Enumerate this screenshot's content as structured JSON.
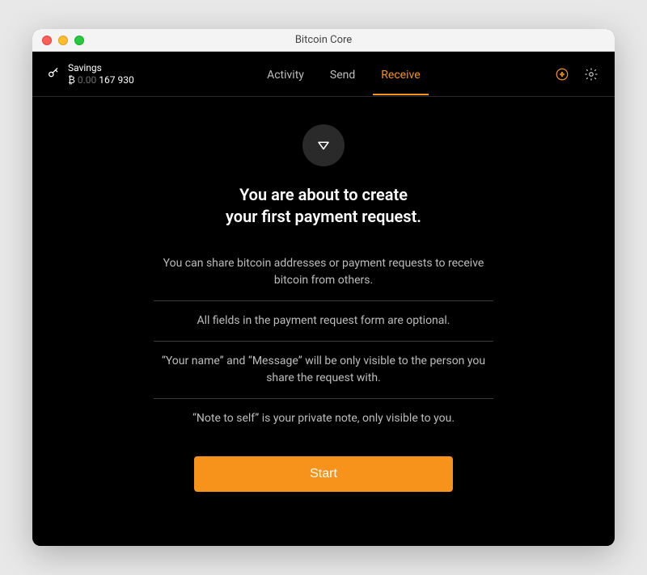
{
  "window": {
    "title": "Bitcoin Core"
  },
  "wallet": {
    "name": "Savings",
    "balance_symbol": "₿",
    "balance_leading_zeros": "0.00",
    "balance_rest": " 167 930"
  },
  "nav": {
    "activity": "Activity",
    "send": "Send",
    "receive": "Receive"
  },
  "headline": {
    "line1": "You are about to create",
    "line2": "your first payment request."
  },
  "info": {
    "item1": "You can share bitcoin addresses or payment requests to receive bitcoin from others.",
    "item2": "All fields in the payment request form are optional.",
    "item3": "“Your name” and “Message” will be only visible to the person you share the request with.",
    "item4": "“Note to self” is your private note, only visible to you."
  },
  "buttons": {
    "start": "Start"
  },
  "colors": {
    "accent": "#f7931a"
  }
}
